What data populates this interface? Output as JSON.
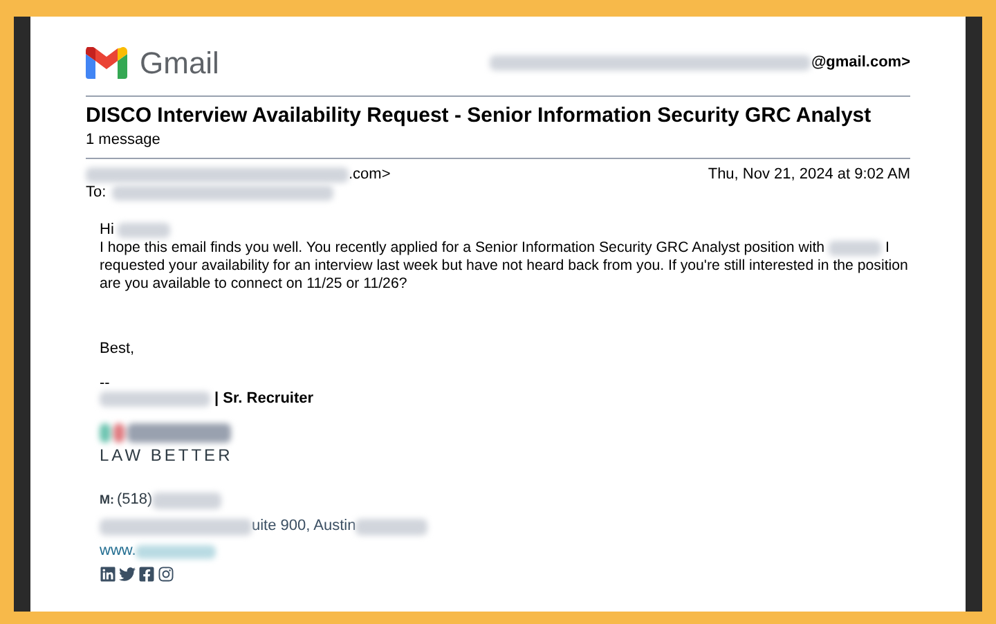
{
  "header": {
    "logo": "Gmail",
    "account": "@gmail.com>"
  },
  "subject": "DISCO Interview Availability Request - Senior Information Security GRC Analyst",
  "message_count": "1 message",
  "from": ".com>",
  "date": "Thu, Nov 21, 2024 at 9:02 AM",
  "to_label": "To:",
  "greeting": "Hi",
  "body_parts": [
    "I hope this email finds you well. You recently applied for a Senior Information Security GRC Analyst position with",
    "I requested your availability for an interview last week but have not heard back from you. If you're still interested in the position are you available to connect on 11/25 or 11/26?"
  ],
  "closing": "Best,",
  "separator": "--",
  "signature": {
    "title": "| Sr. Recruiter",
    "tagline": "LAW BETTER",
    "phone_label": "M:",
    "phone": "(518)",
    "address": "uite 900, Austin",
    "website": "www.",
    "socials": [
      {
        "kind": "linkedin"
      },
      {
        "kind": "twitter"
      },
      {
        "kind": "facebook"
      },
      {
        "kind": "instagram"
      }
    ]
  }
}
